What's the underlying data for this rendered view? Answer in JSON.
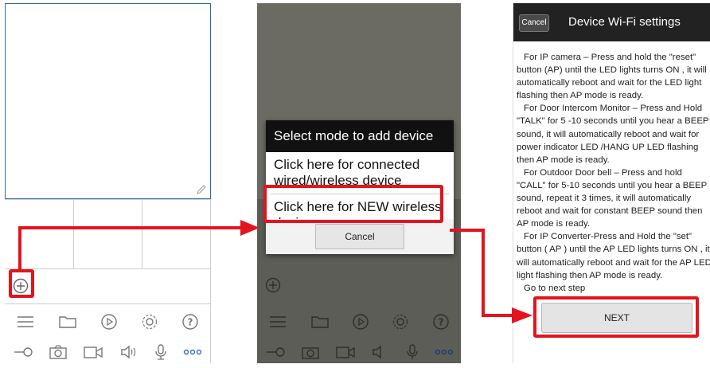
{
  "panel1": {
    "plus_icon": "plus-circle-icon",
    "toolbar_top": [
      "list-icon",
      "folder-icon",
      "playback-icon",
      "gear-icon",
      "help-icon"
    ],
    "toolbar_bottom": [
      "key-icon",
      "camera-icon",
      "video-record-icon",
      "speaker-icon",
      "microphone-icon",
      "more-icon"
    ]
  },
  "dialog": {
    "title": "Select mode to add device",
    "option_connected": "Click here for connected wired/wireless device",
    "option_new": "Click here for NEW wireless device",
    "cancel_label": "Cancel"
  },
  "wifi": {
    "cancel_label": "Cancel",
    "title": "Device Wi-Fi settings",
    "paragraphs": [
      "For IP camera – Press and hold the \"reset\" button (AP) until the LED lights turns ON , it will automatically reboot and wait for the LED light flashing then AP mode is ready.",
      "For Door Intercom Monitor – Press and Hold \"TALK\" for 5 -10 seconds until you hear a BEEP sound, it will automatically reboot and wait for power indicator LED /HANG UP LED flashing then AP mode is ready.",
      "For Outdoor Door bell – Press and hold \"CALL\" for 5-10 seconds until you hear a BEEP sound, repeat it 3 times, it will automatically reboot and wait for constant BEEP sound then AP mode is ready.",
      "For IP Converter-Press and Hold the \"set\" button ( AP ) until the AP LED lights turns ON , it will automatically reboot and wait for the AP LED light flashing then AP mode is ready.",
      "Go to next step"
    ],
    "next_label": "NEXT"
  },
  "colors": {
    "highlight": "#e3141e",
    "frame_blue": "#2b6aa6",
    "more_blue": "#2f6fd6"
  }
}
